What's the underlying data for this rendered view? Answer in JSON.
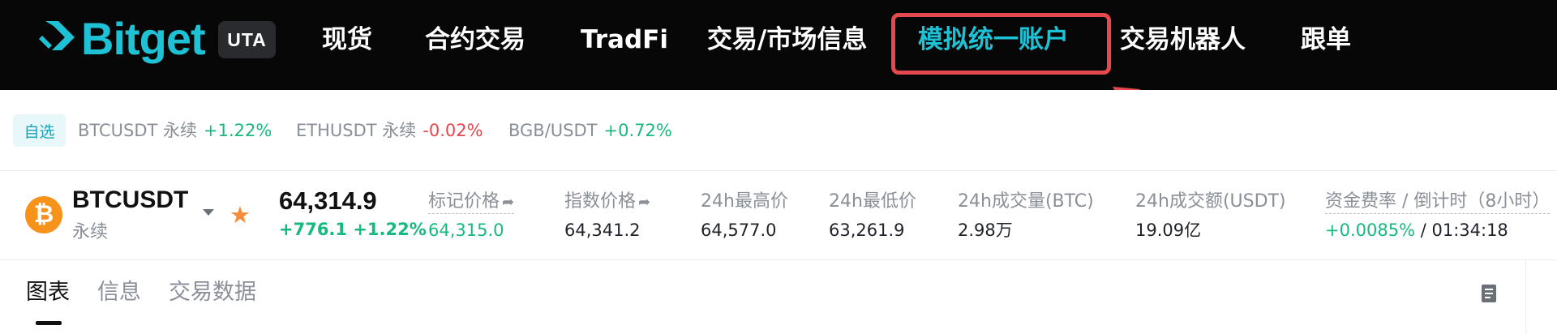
{
  "header": {
    "logo_text": "Bitget",
    "badge": "UTA",
    "nav": [
      {
        "label": "现货"
      },
      {
        "label": "合约交易"
      },
      {
        "label": "TradFi"
      },
      {
        "label": "交易/市场信息"
      },
      {
        "label": "模拟统一账户"
      },
      {
        "label": "交易机器人"
      },
      {
        "label": "跟单"
      }
    ],
    "brand_color": "#1ec2d4",
    "highlight_color": "#e5484d"
  },
  "favorites": {
    "tag": "自选",
    "items": [
      {
        "symbol": "BTCUSDT 永续",
        "change": "+1.22%"
      },
      {
        "symbol": "ETHUSDT 永续",
        "change": "-0.02%"
      },
      {
        "symbol": "BGB/USDT",
        "change": "+0.72%"
      }
    ]
  },
  "ticker": {
    "coin_icon": "bitcoin-icon",
    "coin_symbol": "₿",
    "pair": "BTCUSDT",
    "type": "永续",
    "last_price": "64,314.9",
    "change": "+776.1 +1.22%",
    "stats": [
      {
        "label": "标记价格",
        "value": "64,315.0"
      },
      {
        "label": "指数价格",
        "value": "64,341.2"
      },
      {
        "label": "24h最高价",
        "value": "64,577.0"
      },
      {
        "label": "24h最低价",
        "value": "63,261.9"
      },
      {
        "label": "24h成交量(BTC)",
        "value": "2.98万"
      },
      {
        "label": "24h成交额(USDT)",
        "value": "19.09亿"
      },
      {
        "label": "资金费率 / 倒计时（8小时）",
        "value": "+0.0085%",
        "value_suffix": "/ 01:34:18"
      }
    ]
  },
  "tabs": [
    {
      "label": "图表"
    },
    {
      "label": "信息"
    },
    {
      "label": "交易数据"
    }
  ],
  "colors": {
    "up": "#18b97f",
    "down": "#e5484d"
  }
}
